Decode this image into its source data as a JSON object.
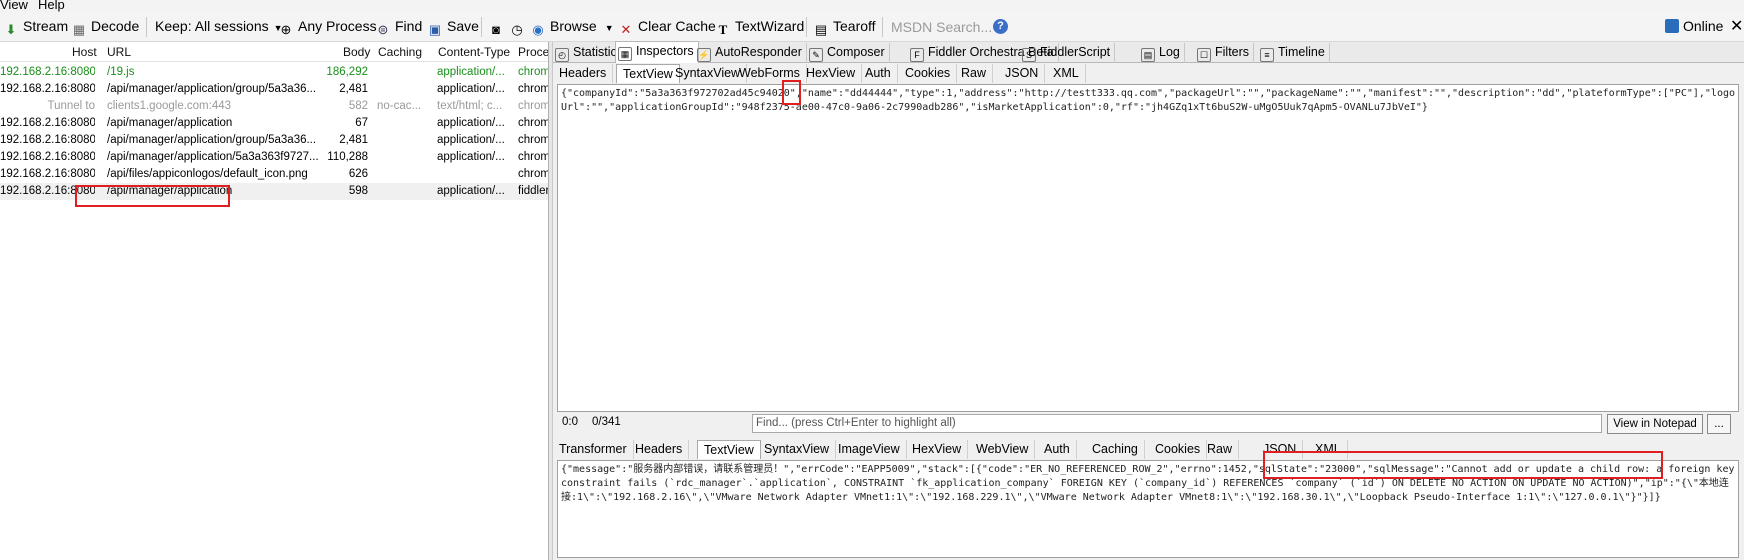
{
  "menu": {
    "view": "View",
    "help": "Help"
  },
  "toolbar": {
    "stream": "Stream",
    "decode": "Decode",
    "keep": "Keep: All sessions",
    "any_process": "Any Process",
    "find": "Find",
    "save": "Save",
    "browse": "Browse",
    "clear_cache": "Clear Cache",
    "textwizard": "TextWizard",
    "tearoff": "Tearoff",
    "search_placeholder": "MSDN Search...",
    "online": "Online"
  },
  "columns": {
    "host": "Host",
    "url": "URL",
    "body": "Body",
    "caching": "Caching",
    "content_type": "Content-Type",
    "process": "Proce"
  },
  "sessions": [
    {
      "host": "192.168.2.16:8080",
      "url": "/19.js",
      "body": "186,292",
      "caching": "",
      "ct": "application/...",
      "proc": "chrom",
      "style": "green"
    },
    {
      "host": "192.168.2.16:8080",
      "url": "/api/manager/application/group/5a3a36...",
      "body": "2,481",
      "caching": "",
      "ct": "application/...",
      "proc": "chrom",
      "style": ""
    },
    {
      "host": "Tunnel to",
      "url": "clients1.google.com:443",
      "body": "582",
      "caching": "no-cac...",
      "ct": "text/html; c...",
      "proc": "chrom",
      "style": "gray"
    },
    {
      "host": "192.168.2.16:8080",
      "url": "/api/manager/application",
      "body": "67",
      "caching": "",
      "ct": "application/...",
      "proc": "chrom",
      "style": ""
    },
    {
      "host": "192.168.2.16:8080",
      "url": "/api/manager/application/group/5a3a36...",
      "body": "2,481",
      "caching": "",
      "ct": "application/...",
      "proc": "chrom",
      "style": ""
    },
    {
      "host": "192.168.2.16:8080",
      "url": "/api/manager/application/5a3a363f9727...",
      "body": "110,288",
      "caching": "",
      "ct": "application/...",
      "proc": "chrom",
      "style": ""
    },
    {
      "host": "192.168.2.16:8080",
      "url": "/api/files/appiconlogos/default_icon.png",
      "body": "626",
      "caching": "",
      "ct": "",
      "proc": "chrom",
      "style": ""
    },
    {
      "host": "192.168.2.16:8080",
      "url": "/api/manager/application",
      "body": "598",
      "caching": "",
      "ct": "application/...",
      "proc": "fiddler",
      "style": "sel"
    }
  ],
  "main_tabs": [
    "Statistics",
    "Inspectors",
    "AutoResponder",
    "Composer",
    "Fiddler Orchestra Beta",
    "FiddlerScript",
    "Log",
    "Filters",
    "Timeline"
  ],
  "request_tabs": [
    "Headers",
    "TextView",
    "SyntaxView",
    "WebForms",
    "HexView",
    "Auth",
    "Cookies",
    "Raw",
    "JSON",
    "XML"
  ],
  "request_body": "{\"companyId\":\"5a3a363f972702ad45c94020\",\"name\":\"dd44444\",\"type\":1,\"address\":\"http://testt333.qq.com\",\"packageUrl\":\"\",\"packageName\":\"\",\"manifest\":\"\",\"description\":\"dd\",\"plateformType\":[\"PC\"],\"logoUrl\":\"\",\"applicationGroupId\":\"948f2375-ae00-47c0-9a06-2c7990adb286\",\"isMarketApplication\":0,\"rf\":\"jh4GZq1xTt6buS2W-uMgO5Uuk7qApm5-OVANLu7JbVeI\"}",
  "find_bar": {
    "pos1": "0:0",
    "pos2": "0/341",
    "placeholder": "Find... (press Ctrl+Enter to highlight all)",
    "view_notepad": "View in Notepad",
    "more": "..."
  },
  "response_tabs": [
    "Transformer",
    "Headers",
    "TextView",
    "SyntaxView",
    "ImageView",
    "HexView",
    "WebView",
    "Auth",
    "Caching",
    "Cookies",
    "Raw",
    "JSON",
    "XML"
  ],
  "response_body": "{\"message\":\"服务器内部错误，请联系管理员！\",\"errCode\":\"EAPP5009\",\"stack\":[{\"code\":\"ER_NO_REFERENCED_ROW_2\",\"errno\":1452,\"sqlState\":\"23000\",\"sqlMessage\":\"Cannot add or update a child row: a foreign key constraint fails (`rdc_manager`.`application`, CONSTRAINT `fk_application_company` FOREIGN KEY (`company_id`) REFERENCES `company` (`id`) ON DELETE NO ACTION ON UPDATE NO ACTION)\",\"ip\":\"{\\\"本地连接:1\\\":\\\"192.168.2.16\\\",\\\"VMware Network Adapter VMnet1:1\\\":\\\"192.168.229.1\\\",\\\"VMware Network Adapter VMnet8:1\\\":\\\"192.168.30.1\\\",\\\"Loopback Pseudo-Interface 1:1\\\":\\\"127.0.0.1\\\"}\"}]}"
}
